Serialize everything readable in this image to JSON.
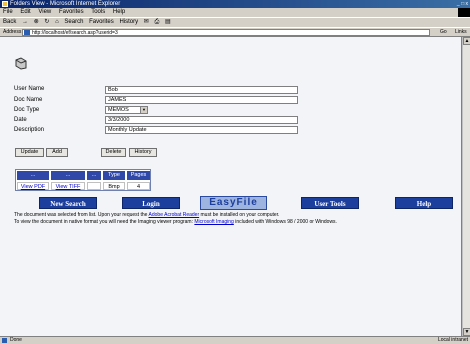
{
  "window": {
    "title": "Folders View - Microsoft Internet Explorer",
    "controls": "_ □ x"
  },
  "menu": [
    "File",
    "Edit",
    "View",
    "Favorites",
    "Tools",
    "Help"
  ],
  "toolbar": {
    "back": "Back",
    "forward": "→",
    "stop": "⊗",
    "refresh": "↻",
    "home": "⌂",
    "search": "Search",
    "favorites": "Favorites",
    "history": "History",
    "mail": "✉",
    "print": "⎙",
    "edit": "▤"
  },
  "address": {
    "label": "Address",
    "url": "http://localhost/ef/search.asp?userid=3",
    "go": "Go",
    "links": "Links"
  },
  "form": {
    "fields": [
      {
        "label": "User Name",
        "value": "Bob"
      },
      {
        "label": "Doc Name",
        "value": "JAMES"
      },
      {
        "label": "Doc Type",
        "value": "MEMOS"
      },
      {
        "label": "Date",
        "value": "3/3/2000"
      },
      {
        "label": "Description",
        "value": "Monthly Update"
      }
    ],
    "buttons": {
      "update": "Update",
      "add": "Add",
      "delete": "Delete",
      "history": "History"
    }
  },
  "results": {
    "headers": [
      "...",
      "...",
      "...",
      "Type",
      "Pages"
    ],
    "row": [
      "View PDF",
      "View TIFF",
      "",
      "Bmp",
      "4"
    ]
  },
  "nav": {
    "new_search": "New Search",
    "login": "Login",
    "brand": "EasyFile",
    "user_tools": "User Tools",
    "help": "Help"
  },
  "messages": {
    "line1_prefix": "The document was selected from list. Upon your request the",
    "line1_link": "Adobe Acrobat Reader",
    "line1_suffix": "must be installed on your computer.",
    "line2_prefix": "To view the document in native format you will need the Imaging viewer program:",
    "line2_link": "Microsoft Imaging",
    "line2_suffix": "included with Windows 98 / 2000 or Windows."
  },
  "status": {
    "text": "Done",
    "zone": "Local intranet"
  },
  "colors": {
    "title_bar": "#0a246a",
    "nav_button": "#1c3e9c",
    "table_header": "#3048a8",
    "link": "#0000cc"
  }
}
